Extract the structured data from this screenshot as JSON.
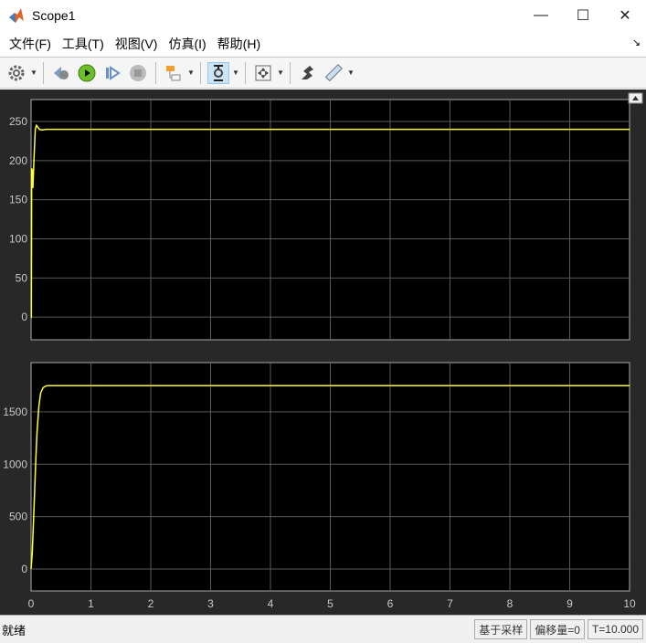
{
  "window": {
    "title": "Scope1",
    "minimize": "—",
    "maximize": "☐",
    "close": "✕"
  },
  "menu": {
    "items": [
      "文件(F)",
      "工具(T)",
      "视图(V)",
      "仿真(I)",
      "帮助(H)"
    ]
  },
  "toolbar": {
    "icons": [
      "gear-icon",
      "restore-config-icon",
      "run-icon",
      "step-forward-icon",
      "stop-icon",
      "signal-selector-icon",
      "zoom-icon",
      "fit-to-view-icon",
      "highlight-simulink-block-icon",
      "measure-icon"
    ]
  },
  "status": {
    "text": "就绪",
    "sample_based": "基于采样",
    "offset": "偏移量=0",
    "time": "T=10.000"
  },
  "colors": {
    "background": "#282828",
    "axes": "#000000",
    "grid": "#5a5a5a",
    "line": "#ffff33",
    "tick": "#c8c8c8"
  },
  "chart_data": [
    {
      "type": "line",
      "xlim": [
        0,
        10
      ],
      "ylim": [
        -29,
        278
      ],
      "yticks": [
        0,
        50,
        100,
        150,
        200,
        250
      ],
      "xticks": [],
      "grid": true,
      "series": [
        {
          "x": [
            0,
            0.005,
            0.01,
            0.02,
            0.03,
            0.05,
            0.07,
            0.09,
            0.11,
            0.14,
            0.18,
            0.25,
            0.4,
            1,
            10
          ],
          "y": [
            0,
            0,
            190,
            188,
            165,
            205,
            240,
            245,
            243,
            240,
            239,
            240,
            240,
            240,
            240
          ]
        }
      ]
    },
    {
      "type": "line",
      "xlim": [
        0,
        10
      ],
      "ylim": [
        -209,
        1970
      ],
      "yticks": [
        0,
        500,
        1000,
        1500
      ],
      "xticks": [
        0,
        1,
        2,
        3,
        4,
        5,
        6,
        7,
        8,
        9,
        10
      ],
      "grid": true,
      "series": [
        {
          "x": [
            0,
            0.02,
            0.05,
            0.08,
            0.1,
            0.13,
            0.16,
            0.2,
            0.25,
            0.3,
            0.4,
            1,
            10
          ],
          "y": [
            0,
            150,
            600,
            1050,
            1300,
            1550,
            1680,
            1730,
            1748,
            1750,
            1750,
            1750,
            1750
          ]
        }
      ]
    }
  ]
}
